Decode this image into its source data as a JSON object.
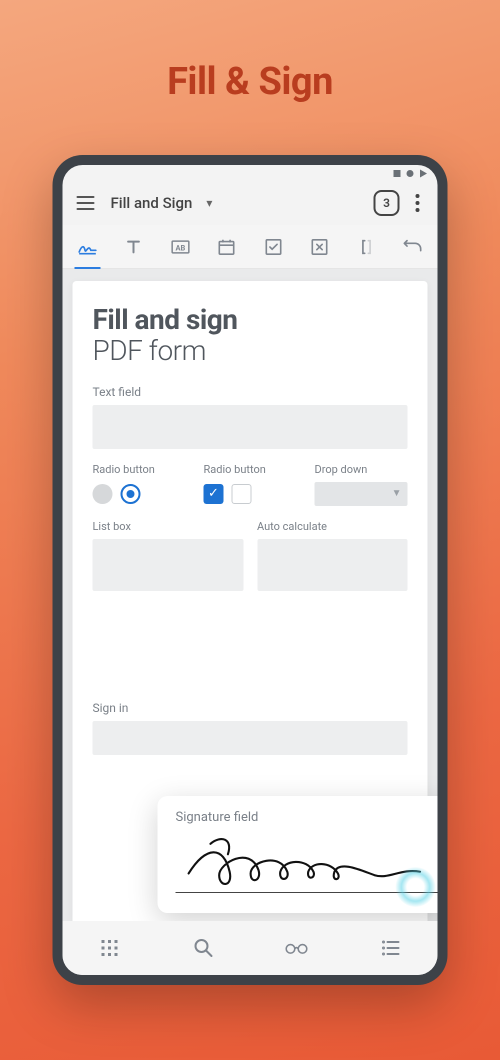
{
  "promo": {
    "title": "Fill & Sign"
  },
  "titlebar": {
    "label": "Fill and Sign",
    "badge": "3"
  },
  "page": {
    "h1_bold": "Fill and sign",
    "h1_thin": "PDF form",
    "text_field_label": "Text field",
    "radio1_label": "Radio button",
    "radio2_label": "Radio button",
    "dd_label": "Drop down",
    "listbox_label": "List box",
    "autocalc_label": "Auto calculate",
    "sign_in_label": "Sign in"
  },
  "sigcard": {
    "label": "Signature field"
  }
}
